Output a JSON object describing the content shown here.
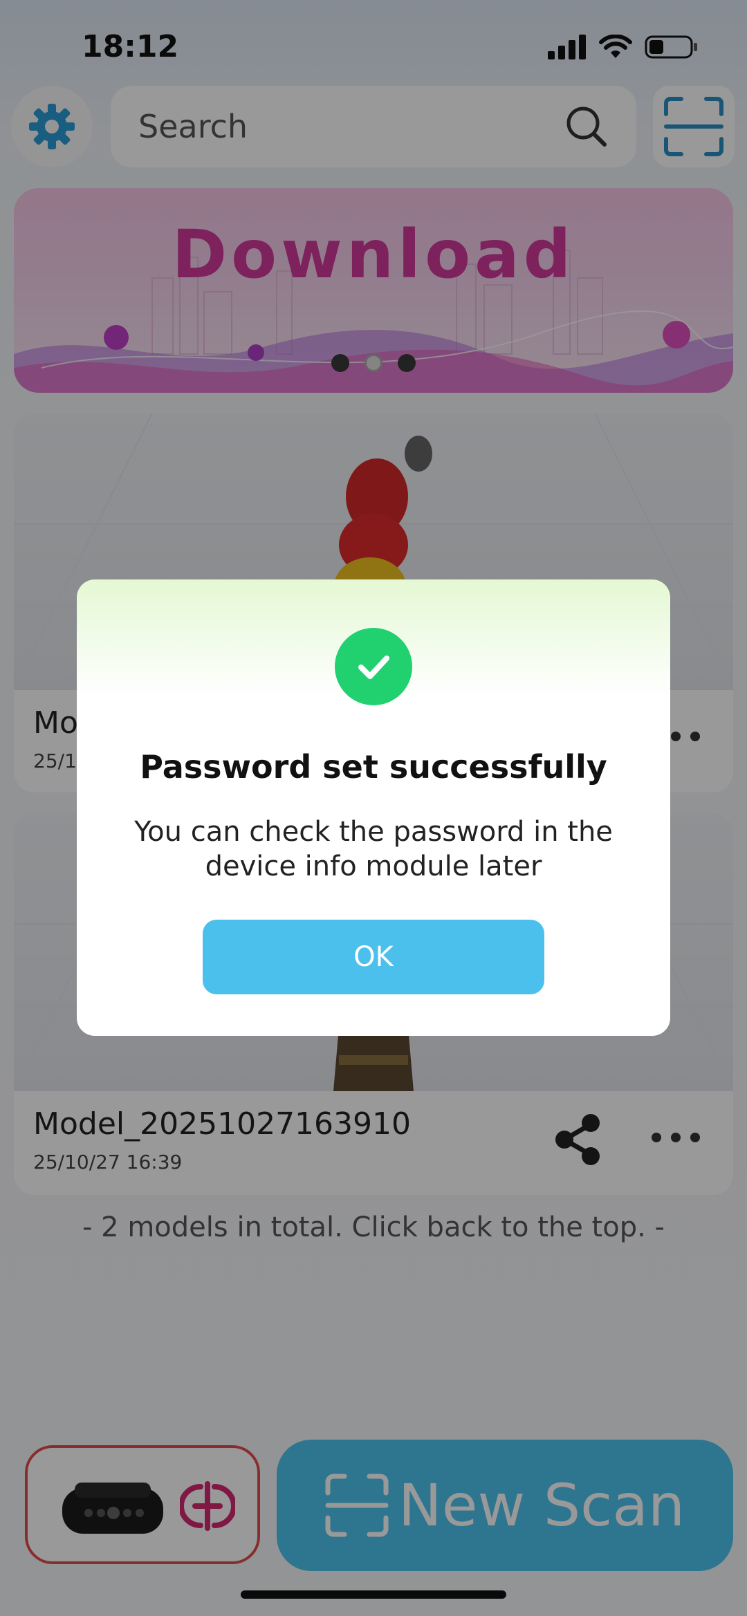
{
  "status_bar": {
    "time": "18:12"
  },
  "search": {
    "placeholder": "Search"
  },
  "banner": {
    "title": "Download",
    "page_count": 3,
    "active_page": 2
  },
  "models": [
    {
      "name": "Model_20251027163910",
      "date": "25/10/27 16:39",
      "name_visible": "Mo",
      "date_visible": "25/1"
    },
    {
      "name": "Model_20251027163910",
      "date": "25/10/27 16:39"
    }
  ],
  "list_footer": "- 2 models in total. Click back to the top. -",
  "bottom_bar": {
    "new_scan_label": "New Scan"
  },
  "dialog": {
    "title": "Password set successfully",
    "message": "You can check the password in the device info module later",
    "ok_label": "OK"
  },
  "colors": {
    "accent": "#4cc0ec",
    "success": "#21d16f",
    "banner_title": "#d03a9a",
    "device_border": "#e34c4c"
  },
  "icons": [
    "settings-gear-icon",
    "search-icon",
    "scan-frame-icon",
    "share-icon",
    "more-icon",
    "scanner-device-icon",
    "connection-icon",
    "checkmark-icon"
  ]
}
